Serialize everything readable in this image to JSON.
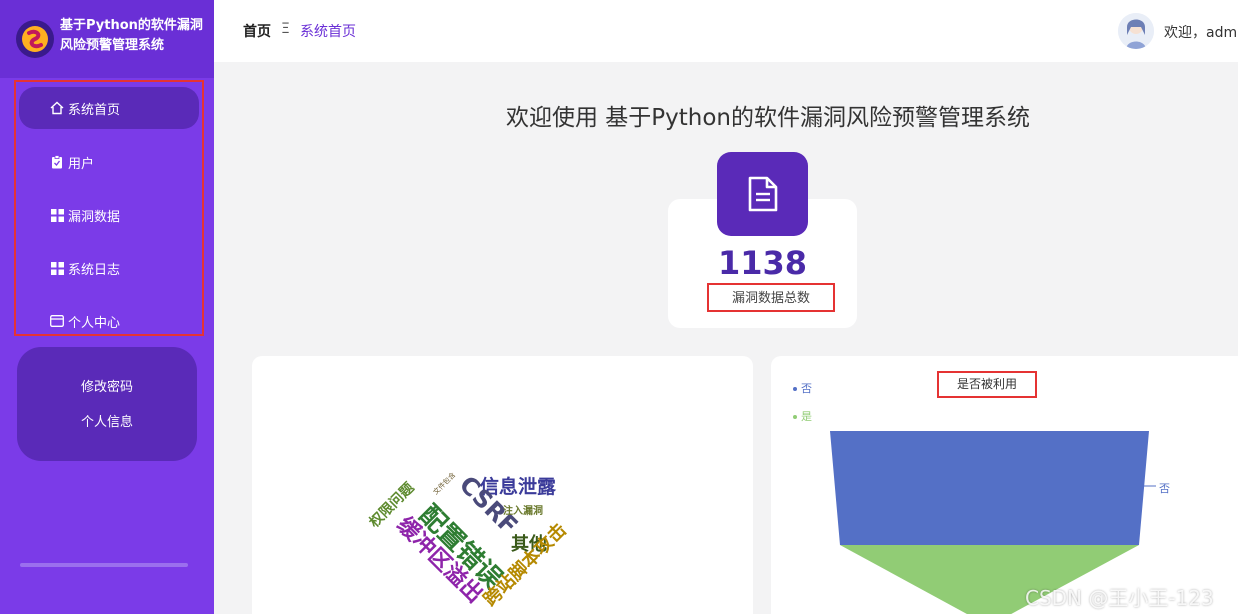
{
  "sidebar": {
    "brand_title": "基于Python的软件漏洞风险预警管理系统",
    "items": [
      {
        "label": "系统首页",
        "icon": "home-icon"
      },
      {
        "label": "用户",
        "icon": "clipboard-icon"
      },
      {
        "label": "漏洞数据",
        "icon": "grid-icon"
      },
      {
        "label": "系统日志",
        "icon": "grid-icon"
      },
      {
        "label": "个人中心",
        "icon": "card-icon"
      }
    ],
    "sub_items": [
      "修改密码",
      "个人信息"
    ]
  },
  "header": {
    "crumb_home": "首页",
    "crumb_sep": "Ξ",
    "crumb_current": "系统首页",
    "welcome": "欢迎，admin"
  },
  "main": {
    "title": "欢迎使用 基于Python的软件漏洞风险预警管理系统",
    "count_value": "1138",
    "count_label": "漏洞数据总数"
  },
  "wordcloud": {
    "words": [
      {
        "text": "信息泄露",
        "color": "#3b3b9a"
      },
      {
        "text": "配置错误",
        "color": "#2e7d32"
      },
      {
        "text": "CSRF",
        "color": "#4a4a7a"
      },
      {
        "text": "缓冲区溢出",
        "color": "#8e24aa"
      },
      {
        "text": "权限问题",
        "color": "#5d8a2e"
      },
      {
        "text": "其他",
        "color": "#3a5a1a"
      },
      {
        "text": "跨站脚本攻击",
        "color": "#b58900"
      },
      {
        "text": "注入漏洞",
        "color": "#6b7a2e"
      },
      {
        "text": "文件包含",
        "color": "#6a5a2e"
      }
    ]
  },
  "funnel": {
    "title": "是否被利用",
    "legend": [
      {
        "label": "否",
        "color": "#5470c6"
      },
      {
        "label": "是",
        "color": "#91cc75"
      }
    ],
    "label_no": "否"
  },
  "watermark": "CSDN @王小王-123"
}
